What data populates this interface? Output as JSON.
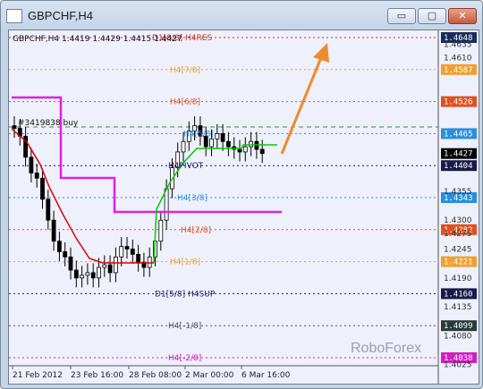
{
  "window": {
    "title": "GBPCHF,H4",
    "buttons": {
      "minimize": "▭",
      "maximize": "▢",
      "close": "✕"
    }
  },
  "chart": {
    "info": "GBPCHF,H4  1.4419 1.4429 1.4415 1.4427",
    "order_label": "#3419838 buy",
    "watermark": "RoboForex"
  },
  "chart_data": {
    "type": "candlestick",
    "symbol": "GBPCHF",
    "timeframe": "H4",
    "ohlc_last": {
      "open": 1.4419,
      "high": 1.4429,
      "low": 1.4415,
      "close": 1.4427
    },
    "price_axis_ticks": [
      "1.4635",
      "1.4610",
      "1.4355",
      "1.4300",
      "1.4275",
      "1.4245",
      "1.4190",
      "1.4135",
      "1.4080",
      "1.4025"
    ],
    "time_axis_labels": [
      "21 Feb 2012",
      "23 Feb 16:00",
      "28 Feb 08:00",
      "2 Mar 00:00",
      "6 Mar 16:00"
    ],
    "murrey_levels": [
      {
        "label": "D1[8/8] H4RES",
        "price": 1.4648,
        "color": "#cc3322"
      },
      {
        "label": "H4[7/8]",
        "price": 1.4587,
        "color": "#f0a030"
      },
      {
        "label": "H4[6/8]",
        "price": 1.4526,
        "color": "#e05020"
      },
      {
        "label": "H4[5/8]",
        "price": 1.4465,
        "color": "#2a8fd8"
      },
      {
        "label": "H4PIVOT",
        "price": 1.4404,
        "color": "#1a1a6a"
      },
      {
        "label": "H4[3/8]",
        "price": 1.4343,
        "color": "#2a8fd8"
      },
      {
        "label": "H4[2/8]",
        "price": 1.4282,
        "color": "#e05020"
      },
      {
        "label": "H4[1/8]",
        "price": 1.4221,
        "color": "#f0a030"
      },
      {
        "label": "D1[5/8] H4SUP",
        "price": 1.416,
        "color": "#1a1a6a"
      },
      {
        "label": "H4[-1/8]",
        "price": 1.4099,
        "color": "#555555"
      },
      {
        "label": "H4[-2/8]",
        "price": 1.4038,
        "color": "#d020c0"
      }
    ],
    "price_badges": [
      {
        "text": "1.4648",
        "bg": "#1a2a5a",
        "fg": "#ffffff",
        "price": 1.4648
      },
      {
        "text": "1.4587",
        "bg": "#f0a030",
        "fg": "#ffffff",
        "price": 1.4587
      },
      {
        "text": "1.4526",
        "bg": "#e05020",
        "fg": "#ffffff",
        "price": 1.4526
      },
      {
        "text": "1.4465",
        "bg": "#2a8fd8",
        "fg": "#ffffff",
        "price": 1.4465
      },
      {
        "text": "1.4427",
        "bg": "#000000",
        "fg": "#ffffff",
        "price": 1.4427
      },
      {
        "text": "1.4404",
        "bg": "#1a1a4a",
        "fg": "#ffffff",
        "price": 1.4404
      },
      {
        "text": "1.4343",
        "bg": "#2a8fd8",
        "fg": "#ffffff",
        "price": 1.4343
      },
      {
        "text": "1.4282",
        "bg": "#e05020",
        "fg": "#ffffff",
        "price": 1.4282
      },
      {
        "text": "1.4221",
        "bg": "#f0a030",
        "fg": "#ffffff",
        "price": 1.4221
      },
      {
        "text": "1.4160",
        "bg": "#1a1a4a",
        "fg": "#ffffff",
        "price": 1.416
      },
      {
        "text": "1.4099",
        "bg": "#2a3a3a",
        "fg": "#ffffff",
        "price": 1.4099
      },
      {
        "text": "1.4038",
        "bg": "#d020c0",
        "fg": "#ffffff",
        "price": 1.4038
      }
    ],
    "colors": {
      "bull_line": "#00cc00",
      "bear_line": "#dd0000",
      "magenta_line": "#e020e0",
      "arrow": "#f08a30"
    }
  }
}
